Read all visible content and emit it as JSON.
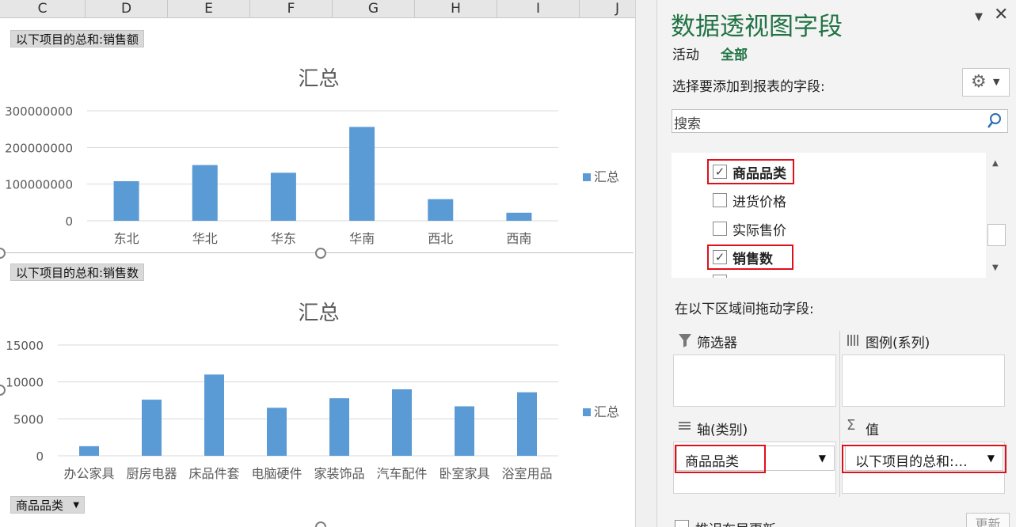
{
  "sheet": {
    "columns": [
      "C",
      "D",
      "E",
      "F",
      "G",
      "H",
      "I",
      "J"
    ]
  },
  "chart1": {
    "field_button": "以下项目的总和:销售额",
    "legend": "汇总"
  },
  "chart2": {
    "field_button": "以下项目的总和:销售数",
    "legend": "汇总",
    "axis_field_button": "商品品类"
  },
  "chart_data": [
    {
      "type": "bar",
      "title": "汇总",
      "categories": [
        "东北",
        "华北",
        "华东",
        "华南",
        "西北",
        "西南"
      ],
      "series": [
        {
          "name": "汇总",
          "values": [
            108000000,
            152000000,
            131000000,
            256000000,
            59000000,
            22000000
          ]
        }
      ],
      "yticks": [
        "0",
        "100000000",
        "200000000",
        "300000000"
      ],
      "ylim": [
        0,
        300000000
      ],
      "xlabel": "",
      "ylabel": "",
      "grid": true,
      "legend_position": "right",
      "bar_color": "#5b9bd5"
    },
    {
      "type": "bar",
      "title": "汇总",
      "categories": [
        "办公家具",
        "厨房电器",
        "床品件套",
        "电脑硬件",
        "家装饰品",
        "汽车配件",
        "卧室家具",
        "浴室用品"
      ],
      "series": [
        {
          "name": "汇总",
          "values": [
            1300,
            7600,
            11000,
            6500,
            7800,
            9000,
            6700,
            8600
          ]
        }
      ],
      "yticks": [
        "0",
        "5000",
        "10000",
        "15000"
      ],
      "ylim": [
        0,
        15000
      ],
      "xlabel": "",
      "ylabel": "",
      "grid": true,
      "legend_position": "right",
      "bar_color": "#5b9bd5"
    }
  ],
  "pane": {
    "title": "数据透视图字段",
    "tab_active": "活动",
    "tab_all": "全部",
    "choose_label": "选择要添加到报表的字段:",
    "search_placeholder": "搜索",
    "fields": [
      {
        "label": "商品品类",
        "checked": true,
        "bold": true
      },
      {
        "label": "进货价格",
        "checked": false,
        "bold": false
      },
      {
        "label": "实际售价",
        "checked": false,
        "bold": false
      },
      {
        "label": "销售数",
        "checked": true,
        "bold": true
      }
    ],
    "drag_label": "在以下区域间拖动字段:",
    "zones": {
      "filters": "筛选器",
      "legend": "图例(系列)",
      "axis": "轴(类别)",
      "values": "值"
    },
    "axis_item": "商品品类",
    "values_item": "以下项目的总和:销售数",
    "defer_label": "推迟布局更新",
    "update_button": "更新",
    "accent_color": "#217346",
    "highlight_color": "#e0101a"
  }
}
